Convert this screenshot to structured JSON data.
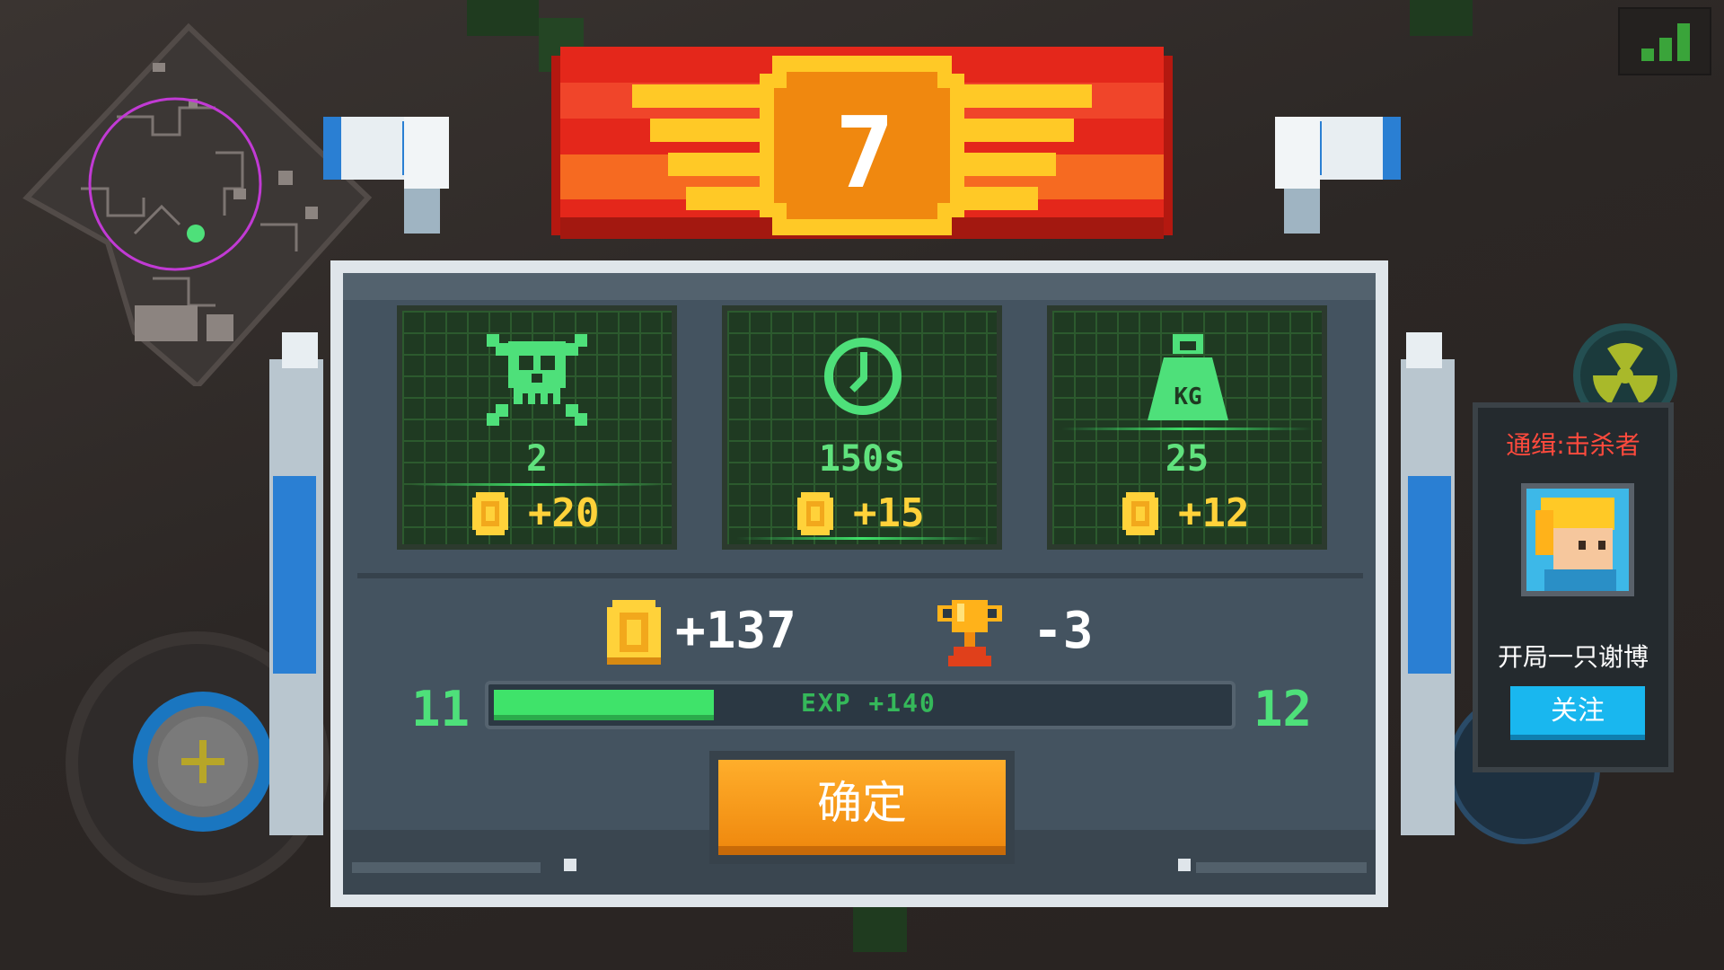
{
  "level_banner": {
    "level": "7"
  },
  "stats": [
    {
      "id": "kills",
      "icon": "skull-icon",
      "value": "2",
      "coin_gain": "+20"
    },
    {
      "id": "time",
      "icon": "clock-icon",
      "value": "150s",
      "coin_gain": "+15"
    },
    {
      "id": "weight",
      "icon": "kg-weight-icon",
      "value": "25",
      "coin_gain": "+12"
    }
  ],
  "totals": {
    "coins": "+137",
    "trophies": "-3"
  },
  "experience": {
    "level_from": "11",
    "level_to": "12",
    "label": "EXP +140",
    "fill_fraction": 0.3
  },
  "confirm_button": {
    "label": "确定"
  },
  "wanted_panel": {
    "title": "通缉:击杀者",
    "player_name": "开局一只谢博",
    "follow_label": "关注"
  },
  "kg_label": "KG",
  "colors": {
    "accent_green": "#3fe36a",
    "coin_yellow": "#ffd23a",
    "confirm_orange": "#f6991a",
    "follow_blue": "#19b7ef",
    "wanted_red": "#ff4a3d",
    "banner_red": "#e4271b"
  }
}
